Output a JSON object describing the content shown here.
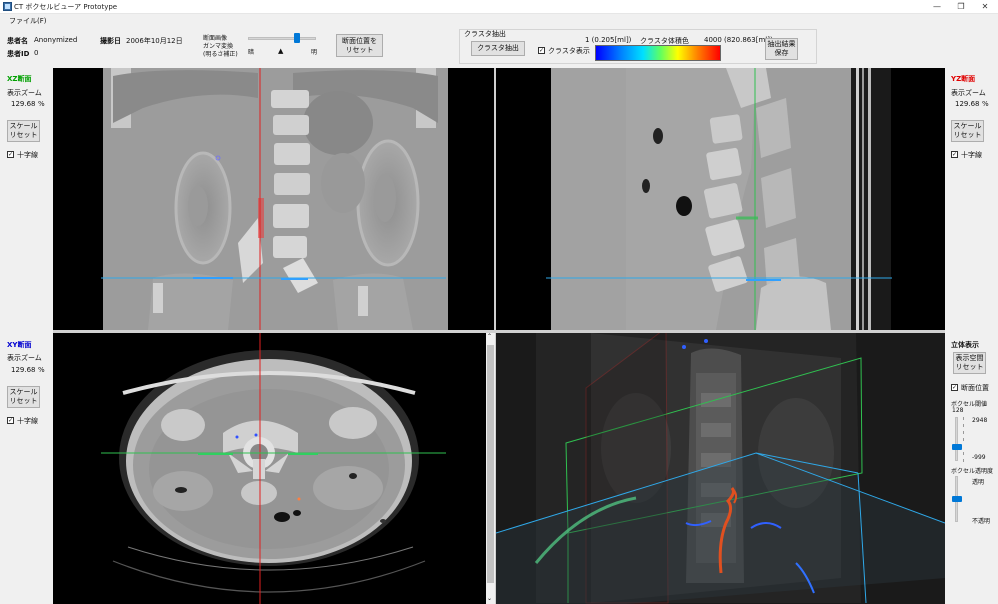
{
  "window": {
    "title": "CT ボクセルビューア Prototype",
    "minimize": "—",
    "maximize": "❐",
    "close": "✕"
  },
  "menu": {
    "file": "ファイル(F)"
  },
  "patient": {
    "name_label": "患者名",
    "name_value": "Anonymized",
    "id_label": "患者ID",
    "id_value": "0",
    "date_label": "撮影日",
    "date_value": "2006年10月12日"
  },
  "gamma": {
    "label_line1": "断面画像",
    "label_line2": "ガンマ変換",
    "label_line3": "(明るさ補正)",
    "dark": "暗",
    "bright": "明",
    "marker": "▲",
    "level": 0.72
  },
  "reset_section_button": {
    "line1": "断面位置を",
    "line2": "リセット"
  },
  "cluster": {
    "group_title": "クラスタ抽出",
    "extract_button": "クラスタ抽出",
    "show_checkbox": "クラスタ表示",
    "show_checked": true,
    "range_min": "1 (0.205[ml])",
    "color_label": "クラスタ体積色",
    "range_max": "4000 (820.863[ml])",
    "save_button_line1": "抽出結果",
    "save_button_line2": "保存"
  },
  "xz_panel": {
    "title": "XZ断面",
    "title_color": "#00a000",
    "zoom_label": "表示ズーム",
    "zoom_value": "129.68",
    "zoom_unit": "%",
    "scale_reset_line1": "スケール",
    "scale_reset_line2": "リセット",
    "crosshair": "十字線",
    "crosshair_checked": true
  },
  "xy_panel": {
    "title": "XY断面",
    "title_color": "#0000d0",
    "zoom_label": "表示ズーム",
    "zoom_value": "129.68",
    "zoom_unit": "%",
    "scale_reset_line1": "スケール",
    "scale_reset_line2": "リセット",
    "crosshair": "十字線",
    "crosshair_checked": true
  },
  "yz_panel": {
    "title": "YZ断面",
    "title_color": "#e00000",
    "zoom_label": "表示ズーム",
    "zoom_value": "129.68",
    "zoom_unit": "%",
    "scale_reset_line1": "スケール",
    "scale_reset_line2": "リセット",
    "crosshair": "十字線",
    "crosshair_checked": true
  },
  "volume_panel": {
    "title": "立体表示",
    "reset_line1": "表示空間",
    "reset_line2": "リセット",
    "section_position": "断面位置",
    "section_checked": true,
    "threshold_label": "ボクセル閾値",
    "threshold_value": "128",
    "threshold_max": "2948",
    "threshold_min": "-999",
    "threshold_level": 0.33,
    "opacity_label": "ボクセル透明度",
    "opacity_top": "透明",
    "opacity_bottom": "不透明",
    "opacity_level": 0.5
  },
  "colors": {
    "crosshair_red": "#e02020",
    "crosshair_blue": "#2fa8e8",
    "crosshair_green": "#30c050",
    "accent": "#0078d7"
  }
}
